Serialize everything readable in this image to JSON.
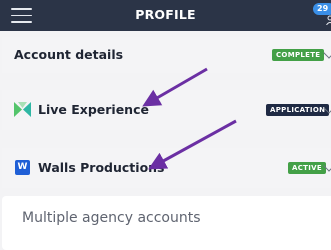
{
  "header": {
    "title": "PROFILE",
    "notification_count": "29"
  },
  "sections": [
    {
      "label": "Account details",
      "status": "COMPLETE",
      "status_color": "#43a047"
    },
    {
      "label": "Live Experience",
      "status": "APPLICATION",
      "status_color": "#1f2a44"
    },
    {
      "label": "Walls Productions",
      "status": "ACTIVE",
      "status_color": "#43a047",
      "logo_letter": "W"
    }
  ],
  "footer": {
    "multiple_accounts_label": "Multiple agency accounts"
  },
  "colors": {
    "header_bg": "#2b3447",
    "arrow": "#6b2fa3",
    "walls_logo": "#1f5fd6"
  }
}
